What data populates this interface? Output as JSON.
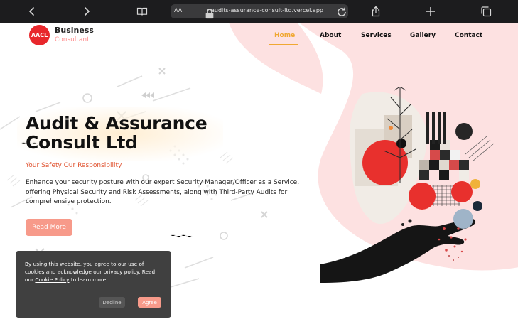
{
  "browser": {
    "text_size_label": "AA",
    "url": "audits-assurance-consult-ltd.vercel.app",
    "icons": [
      "back-icon",
      "forward-icon",
      "reader-icon",
      "lock-icon",
      "reload-icon",
      "share-icon",
      "new-tab-icon",
      "tabs-icon"
    ]
  },
  "header": {
    "logo_text": "AACL",
    "brand_line1": "Business",
    "brand_line2": "Consultant",
    "nav": [
      {
        "label": "Home",
        "active": true
      },
      {
        "label": "About",
        "active": false
      },
      {
        "label": "Services",
        "active": false
      },
      {
        "label": "Gallery",
        "active": false
      },
      {
        "label": "Contact",
        "active": false
      }
    ]
  },
  "hero": {
    "title_line1": "Audit & Assurance",
    "title_line2": "Consult Ltd",
    "tagline": "Your Safety Our Responsibility",
    "description": "Enhance your security posture with our expert Security Manager/Officer as a Service, offering Physical Security and Risk Assessments, along with Third-Party Audits for comprehensive protection.",
    "cta_label": "Read More"
  },
  "cookie_banner": {
    "text_before": "By using this website, you agree to our use of cookies and acknowledge our privacy policy. Read our ",
    "link_text": "Cookie Policy",
    "text_after": " to learn more.",
    "decline_label": "Decline",
    "agree_label": "Agree"
  },
  "colors": {
    "accent": "#f0a832",
    "brand_red": "#e8272c",
    "blob_pink": "#fde1e1",
    "button_pink": "#f79a8a",
    "chrome_bg": "#1c1c1e",
    "cookie_bg": "#404040"
  }
}
